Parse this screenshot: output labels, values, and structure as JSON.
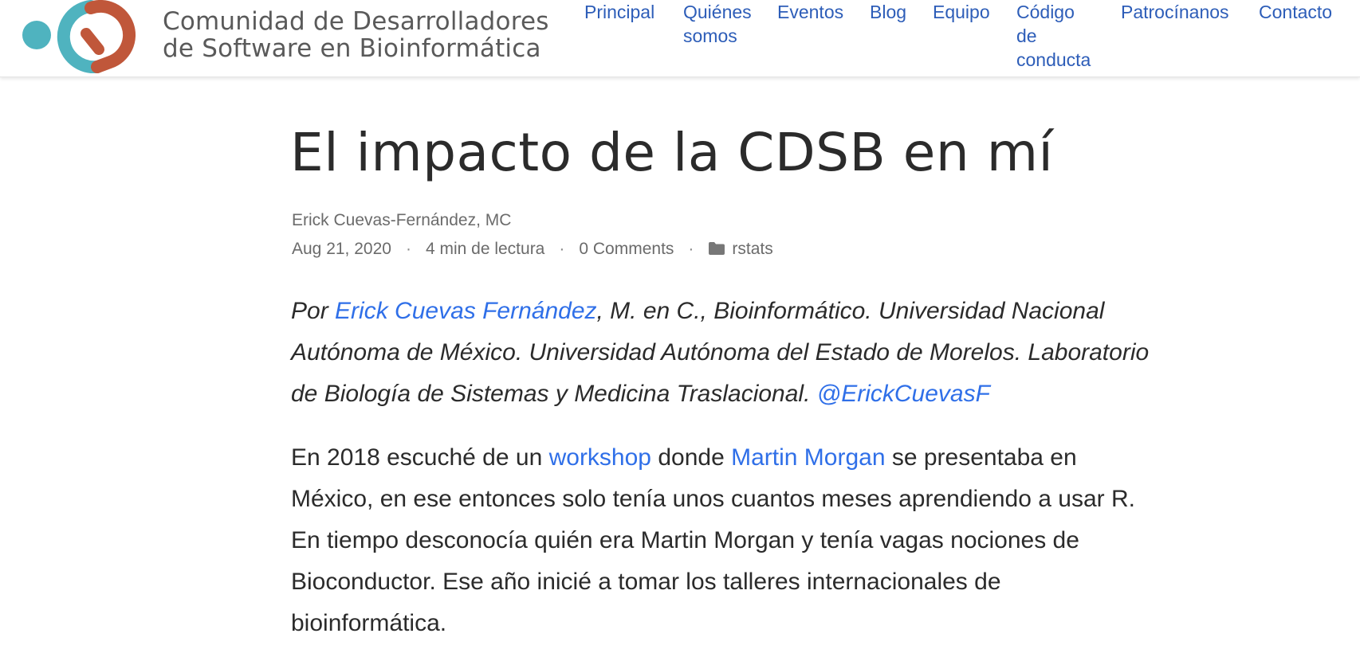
{
  "site": {
    "logo_line1": "Comunidad de Desarrolladores",
    "logo_line2": "de Software en Bioinformática",
    "logo_colors": {
      "teal": "#4fb3bf",
      "orange": "#c0573a"
    }
  },
  "nav": {
    "principal": "Principal",
    "quienes_1": "Quiénes",
    "quienes_2": "somos",
    "eventos": "Eventos",
    "blog": "Blog",
    "equipo": "Equipo",
    "codigo_1": "Código",
    "codigo_2": "de",
    "codigo_3": "conducta",
    "patrocinanos": "Patrocínanos",
    "contacto": "Contacto"
  },
  "post": {
    "title": "El impacto de la CDSB en mí",
    "author": "Erick Cuevas-Fernández, MC",
    "date": "Aug 21, 2020",
    "reading_time": "4 min de lectura",
    "comments": "0 Comments",
    "category": "rstats",
    "separator": "·",
    "folder_icon": "folder-icon"
  },
  "byline": {
    "prefix": "Por ",
    "author_link": "Erick Cuevas Fernández",
    "affiliation": ", M. en C., Bioinformático. Universidad Nacional Autónoma de México. Universidad Autónoma del Estado de Morelos. Laboratorio de Biología de Sistemas y Medicina Traslacional. ",
    "twitter_link": "@ErickCuevasF"
  },
  "paragraph": {
    "part1": "En 2018 escuché de un ",
    "workshop_link": "workshop",
    "part2": " donde ",
    "morgan_link": "Martin Morgan",
    "part3": " se presentaba en México, en ese entonces solo tenía unos cuantos meses aprendiendo a usar R. En tiempo desconocía quién era Martin Morgan y tenía vagas nociones de Bioconductor. Ese año inicié a tomar los talleres internacionales de bioinformática."
  },
  "colors": {
    "link": "#2f6fe8",
    "nav_link": "#2d5db8",
    "text": "#2b2b2b",
    "muted": "#6b6b6b"
  }
}
